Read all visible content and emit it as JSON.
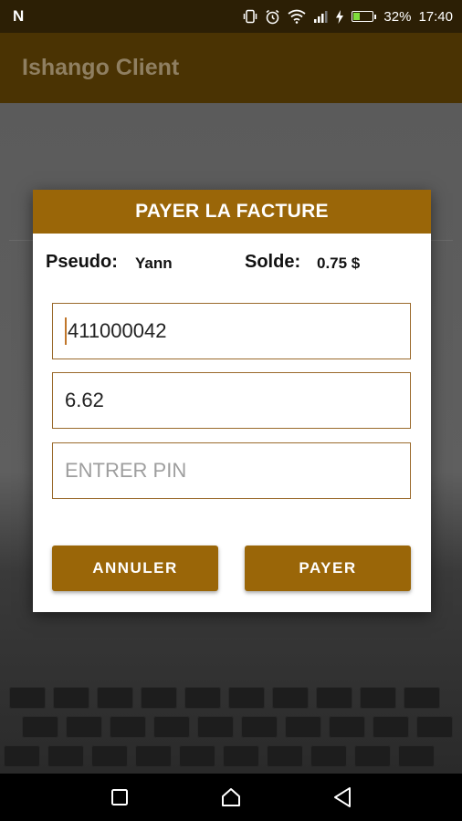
{
  "status_bar": {
    "notification_icon": "N",
    "battery_percent": "32%",
    "time": "17:40",
    "battery_level": 0.32,
    "icons": [
      "vibrate-icon",
      "alarm-icon",
      "wifi-icon",
      "signal-icon",
      "charging-icon",
      "battery-icon"
    ]
  },
  "app_bar": {
    "title": "Ishango Client"
  },
  "dialog": {
    "title": "PAYER LA FACTURE",
    "pseudo_label": "Pseudo:",
    "pseudo_value": "Yann",
    "solde_label": "Solde:",
    "solde_value": "0.75 $",
    "account_field_value": "411000042",
    "amount_field_value": "6.62",
    "pin_field_value": "",
    "pin_placeholder": "ENTRER PIN",
    "cancel_label": "ANNULER",
    "pay_label": "PAYER"
  },
  "nav_bar": {
    "buttons": [
      "recents-icon",
      "home-icon",
      "back-icon"
    ]
  },
  "colors": {
    "accent": "#9a6608",
    "app_bar": "#4a3303",
    "field_border": "#9a6a2c"
  }
}
